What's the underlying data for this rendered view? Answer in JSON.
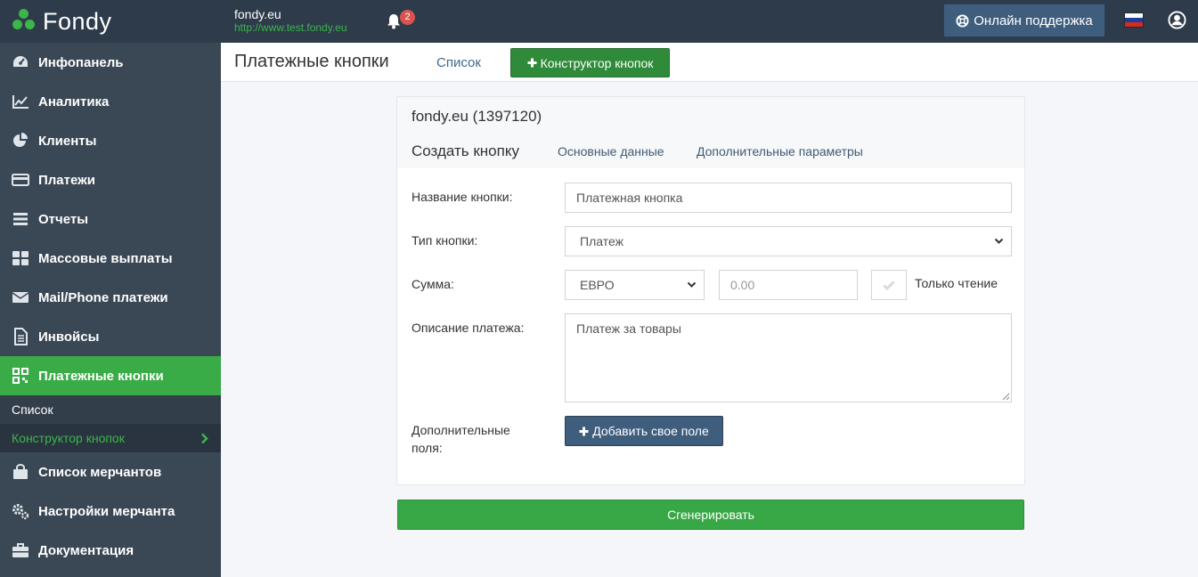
{
  "brand": {
    "logo_text": "Fondy",
    "accent": "#3cb54a"
  },
  "topbar": {
    "merchant_name": "fondy.eu",
    "merchant_url": "http://www.test.fondy.eu",
    "notifications_count": "2",
    "support_label": "Онлайн поддержка",
    "language": "ru"
  },
  "sidebar": {
    "items": [
      {
        "label": "Инфопанель",
        "icon": "dashboard-icon"
      },
      {
        "label": "Аналитика",
        "icon": "chart-line-icon"
      },
      {
        "label": "Клиенты",
        "icon": "pie-chart-icon"
      },
      {
        "label": "Платежи",
        "icon": "credit-card-icon"
      },
      {
        "label": "Отчеты",
        "icon": "list-icon"
      },
      {
        "label": "Массовые выплаты",
        "icon": "grid-icon"
      },
      {
        "label": "Mail/Phone платежи",
        "icon": "envelope-icon"
      },
      {
        "label": "Инвойсы",
        "icon": "document-icon"
      },
      {
        "label": "Платежные кнопки",
        "icon": "qrcode-icon"
      },
      {
        "label": "Список мерчантов",
        "icon": "shopping-bag-icon"
      },
      {
        "label": "Настройки мерчанта",
        "icon": "gears-icon"
      },
      {
        "label": "Документация",
        "icon": "briefcase-icon"
      }
    ],
    "submenu": [
      {
        "label": "Список"
      },
      {
        "label": "Конструктор кнопок"
      }
    ]
  },
  "header": {
    "title": "Платежные кнопки",
    "tab_list": "Список",
    "constructor_button": "Конструктор кнопок"
  },
  "card": {
    "merchant_id": "fondy.eu (1397120)",
    "create_label": "Создать кнопку",
    "tab_main": "Основные данные",
    "tab_extra": "Дополнительные параметры"
  },
  "form": {
    "name_label": "Название кнопки:",
    "name_value": "Платежная кнопка",
    "type_label": "Тип кнопки:",
    "type_value": "Платеж",
    "amount_label": "Сумма:",
    "currency_value": "ЕВРО",
    "amount_placeholder": "0.00",
    "readonly_label": "Только чтение",
    "description_label": "Описание платежа:",
    "description_value": "Платеж за товары",
    "extra_fields_label_line1": "Дополнительные",
    "extra_fields_label_line2": "поля:",
    "add_field_button": "Добавить свое поле",
    "generate_button": "Сгенерировать"
  }
}
